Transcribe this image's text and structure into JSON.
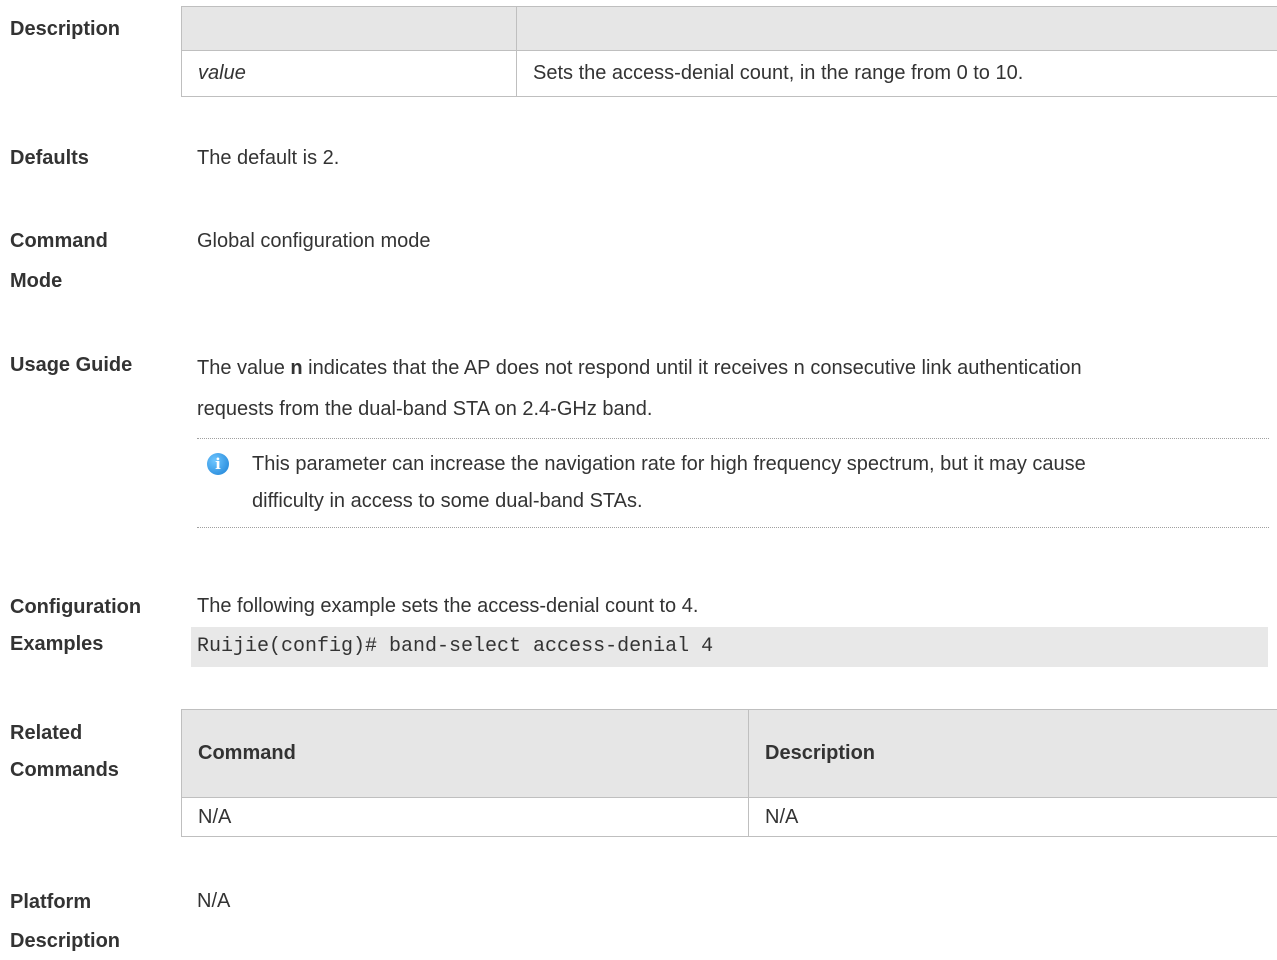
{
  "sections": {
    "description": {
      "label": "Description",
      "table": {
        "header": [
          "",
          ""
        ],
        "rows": [
          {
            "param": "value",
            "desc": "Sets the access-denial count, in the range from 0 to 10."
          }
        ]
      }
    },
    "defaults": {
      "label": "Defaults",
      "text": "The default is 2."
    },
    "command_mode": {
      "label_line1": "Command",
      "label_line2": "Mode",
      "text": "Global configuration mode"
    },
    "usage_guide": {
      "label": "Usage Guide",
      "text_pre": "The value ",
      "text_bold": "n",
      "text_post": " indicates that the AP does not respond until it receives n consecutive link authentication",
      "text_line2": "requests from the dual-band STA on 2.4-GHz band.",
      "note_icon": "info-icon",
      "note_line1": "This parameter can increase the navigation rate for high frequency spectrum, but it may cause",
      "note_line2": "difficulty in access to some dual-band STAs."
    },
    "config_examples": {
      "label_line1": "Configuration",
      "label_line2": "Examples",
      "text": "The following example sets the access-denial count to 4.",
      "code": "Ruijie(config)# band-select access-denial 4"
    },
    "related_commands": {
      "label_line1": "Related",
      "label_line2": "Commands",
      "header": {
        "col1": "Command",
        "col2": "Description"
      },
      "rows": [
        {
          "col1": "N/A",
          "col2": "N/A"
        }
      ]
    },
    "platform_description": {
      "label_line1": "Platform",
      "label_line2": "Description",
      "text": "N/A"
    }
  },
  "colors": {
    "table_header_bg": "#e6e6e6",
    "code_bg": "#e8e8e8",
    "info_icon": "#1a7fd4"
  }
}
